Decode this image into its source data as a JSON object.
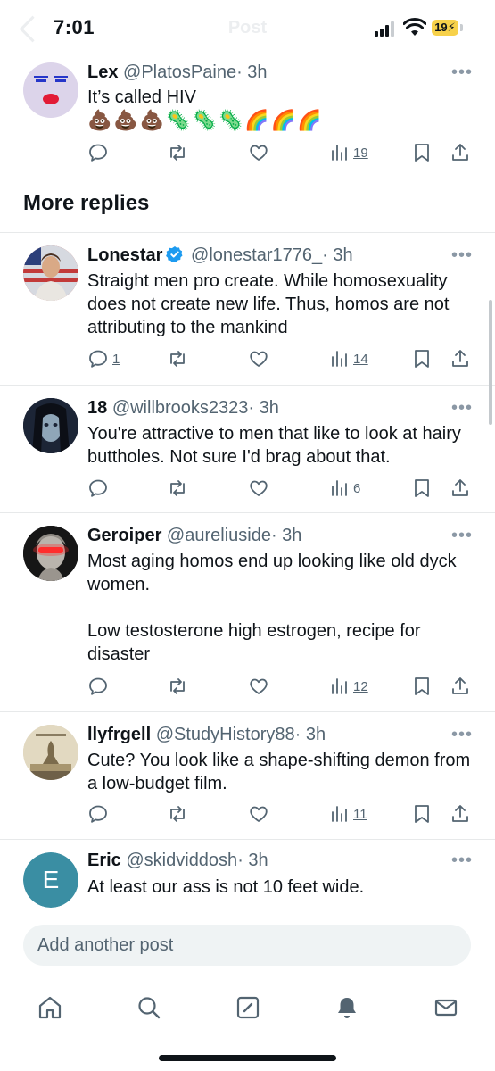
{
  "status_bar": {
    "time": "7:01",
    "faded_title": "Post",
    "battery": "19"
  },
  "top_tweet": {
    "name": "Lex",
    "handle": "@PlatosPaine",
    "time": "· 3h",
    "text": "It’s called HIV",
    "emojis": "💩💩💩🦠🦠🦠🌈🌈🌈",
    "views": "19"
  },
  "section_title": "More replies",
  "replies": [
    {
      "name": "Lonestar",
      "verified": true,
      "handle": "@lonestar1776_",
      "time": "· 3h",
      "text": "Straight men pro create. While homosexuality does not create new life. Thus, homos are not attributing to the mankind",
      "replies": "1",
      "views": "14"
    },
    {
      "name": "18",
      "verified": false,
      "handle": "@willbrooks2323",
      "time": "· 3h",
      "text": "You're attractive to men that like to look at hairy buttholes.   Not sure I'd brag about that.",
      "replies": "",
      "views": "6"
    },
    {
      "name": "Geroiper",
      "verified": false,
      "handle": "@aureliuside",
      "time": "· 3h",
      "text": "Most aging homos end up looking like old dyck women.\n\nLow testosterone high estrogen, recipe for disaster",
      "replies": "",
      "views": "12"
    },
    {
      "name": "llyfrgell",
      "verified": false,
      "handle": "@StudyHistory88",
      "time": "· 3h",
      "text": "Cute? You look like a shape-shifting demon from a low-budget film.",
      "replies": "",
      "views": "11"
    },
    {
      "name": "Eric",
      "verified": false,
      "handle": "@skidviddosh",
      "time": "· 3h",
      "text": "At least our ass is not 10 feet wide.",
      "avatar_letter": "E"
    }
  ],
  "composer": {
    "placeholder": "Add another post"
  },
  "nav": [
    "home-icon",
    "search-icon",
    "compose-icon",
    "notifications-icon",
    "messages-icon"
  ],
  "colors": {
    "accent": "#1d9bf0",
    "text": "#0f1419",
    "muted": "#536471",
    "divider": "#e7e9ea"
  }
}
